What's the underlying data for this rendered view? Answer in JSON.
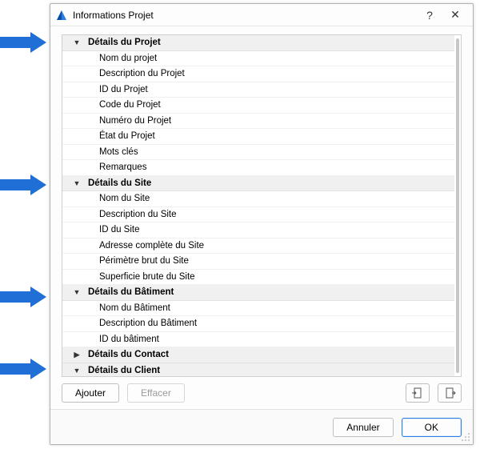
{
  "window": {
    "title": "Informations Projet"
  },
  "arrows": [
    40,
    218,
    358,
    448
  ],
  "tree": [
    {
      "type": "header",
      "state": "expanded",
      "label": "Détails du Projet"
    },
    {
      "type": "child",
      "label": "Nom du projet"
    },
    {
      "type": "child",
      "label": "Description du Projet"
    },
    {
      "type": "child",
      "label": "ID du Projet"
    },
    {
      "type": "child",
      "label": "Code du Projet"
    },
    {
      "type": "child",
      "label": "Numéro du Projet"
    },
    {
      "type": "child",
      "label": "État du Projet"
    },
    {
      "type": "child",
      "label": "Mots clés"
    },
    {
      "type": "child",
      "label": "Remarques"
    },
    {
      "type": "header",
      "state": "expanded",
      "label": "Détails du Site"
    },
    {
      "type": "child",
      "label": "Nom du Site"
    },
    {
      "type": "child",
      "label": "Description du Site"
    },
    {
      "type": "child",
      "label": "ID du Site"
    },
    {
      "type": "child",
      "label": "Adresse complète du Site"
    },
    {
      "type": "child",
      "label": "Périmètre brut du Site"
    },
    {
      "type": "child",
      "label": "Superficie brute du Site"
    },
    {
      "type": "header",
      "state": "expanded",
      "label": "Détails du Bâtiment"
    },
    {
      "type": "child",
      "label": "Nom du Bâtiment"
    },
    {
      "type": "child",
      "label": "Description du Bâtiment"
    },
    {
      "type": "child",
      "label": "ID du bâtiment"
    },
    {
      "type": "header",
      "state": "collapsed",
      "label": "Détails du Contact"
    },
    {
      "type": "header",
      "state": "expanded",
      "label": "Détails du Client"
    }
  ],
  "toolbar": {
    "add": "Ajouter",
    "clear": "Effacer"
  },
  "footer": {
    "cancel": "Annuler",
    "ok": "OK"
  }
}
